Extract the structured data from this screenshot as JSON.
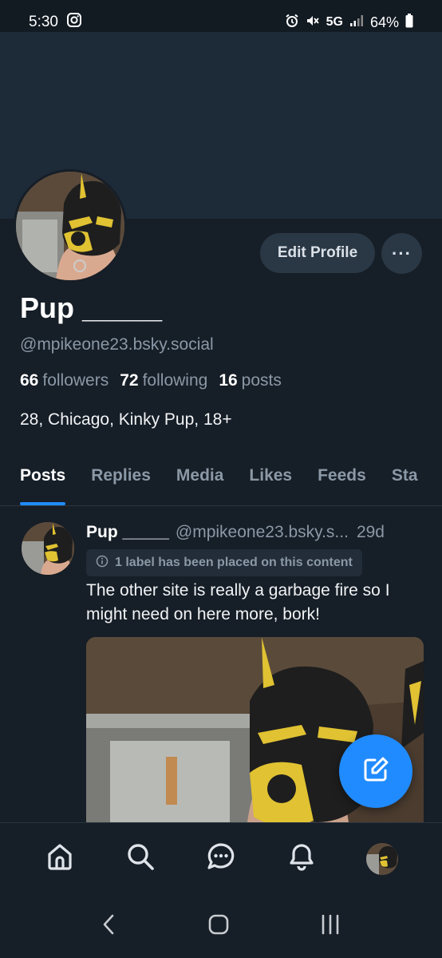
{
  "status_bar": {
    "time": "5:30",
    "network": "5G",
    "battery": "64%",
    "icons": [
      "instagram-icon",
      "alarm-icon",
      "mute-icon",
      "signal-icon",
      "battery-icon"
    ]
  },
  "profile": {
    "display_name": "Pup _____",
    "handle": "@mpikeone23.bsky.social",
    "followers_count": "66",
    "followers_label": "followers",
    "following_count": "72",
    "following_label": "following",
    "posts_count": "16",
    "posts_label": "posts",
    "bio": "28, Chicago, Kinky Pup, 18+",
    "edit_button": "Edit Profile",
    "more_button": "···"
  },
  "tabs": [
    {
      "label": "Posts",
      "active": true
    },
    {
      "label": "Replies",
      "active": false
    },
    {
      "label": "Media",
      "active": false
    },
    {
      "label": "Likes",
      "active": false
    },
    {
      "label": "Feeds",
      "active": false
    },
    {
      "label": "Sta",
      "active": false
    }
  ],
  "post": {
    "author": "Pup _____",
    "handle": "@mpikeone23.bsky.s...",
    "time": "29d",
    "label_notice": "1 label has been placed on this content",
    "text": "The other site is really a garbage fire so I might need on here more, bork!"
  },
  "bottom_nav": [
    "home-icon",
    "search-icon",
    "chat-icon",
    "bell-icon",
    "profile-avatar"
  ],
  "colors": {
    "background": "#161e27",
    "banner": "#1d2a37",
    "accent": "#208bfe",
    "muted_text": "#8b98a6",
    "button_bg": "#2a3744"
  }
}
